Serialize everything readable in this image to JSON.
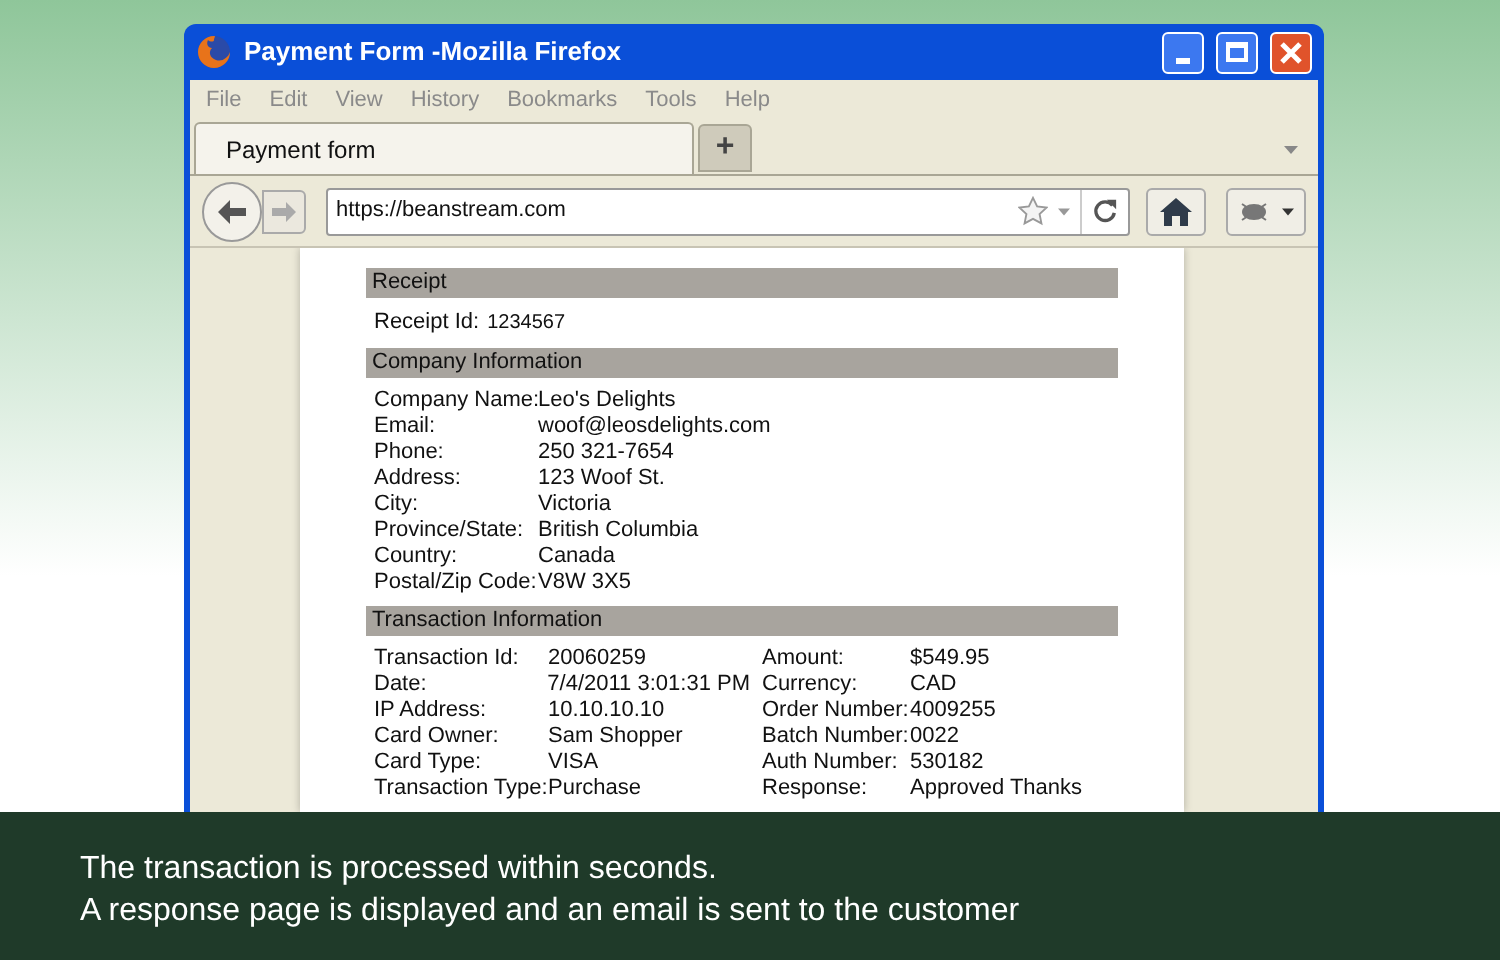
{
  "window": {
    "title": "Payment Form -Mozilla Firefox"
  },
  "menu": [
    "File",
    "Edit",
    "View",
    "History",
    "Bookmarks",
    "Tools",
    "Help"
  ],
  "tabs": [
    {
      "label": "Payment form",
      "selected": true
    }
  ],
  "new_tab": "+",
  "address": {
    "value": "https://beanstream.com"
  },
  "receipt": {
    "heading": "Receipt",
    "label": "Receipt Id:",
    "value": "1234567"
  },
  "company": {
    "heading": "Company Information",
    "rows": [
      {
        "label": "Company Name:",
        "value": "Leo's Delights"
      },
      {
        "label": "Email:",
        "value": "woof@leosdelights.com"
      },
      {
        "label": "Phone:",
        "value": "250 321-7654"
      },
      {
        "label": "Address:",
        "value": "123 Woof St."
      },
      {
        "label": "City:",
        "value": "Victoria"
      },
      {
        "label": "Province/State:",
        "value": "British Columbia"
      },
      {
        "label": "Country:",
        "value": "Canada"
      },
      {
        "label": "Postal/Zip Code:",
        "value": "V8W 3X5"
      }
    ]
  },
  "transaction": {
    "heading": "Transaction Information",
    "left": [
      {
        "label": "Transaction Id:",
        "value": "20060259"
      },
      {
        "label": "Date:",
        "value": "7/4/2011 3:01:31 PM"
      },
      {
        "label": "IP Address:",
        "value": "10.10.10.10"
      },
      {
        "label": "Card Owner:",
        "value": "Sam Shopper"
      },
      {
        "label": "Card Type:",
        "value": "VISA"
      },
      {
        "label": "Transaction Type:",
        "value": "Purchase"
      }
    ],
    "right": [
      {
        "label": "Amount:",
        "value": "$549.95"
      },
      {
        "label": "Currency:",
        "value": "CAD"
      },
      {
        "label": "Order Number:",
        "value": "4009255"
      },
      {
        "label": "Batch Number:",
        "value": "0022"
      },
      {
        "label": "Auth Number:",
        "value": "530182"
      },
      {
        "label": "Response:",
        "value": "Approved Thanks"
      }
    ]
  },
  "caption": [
    "The transaction is processed within seconds.",
    "A response page is displayed and an email is sent to the customer"
  ]
}
